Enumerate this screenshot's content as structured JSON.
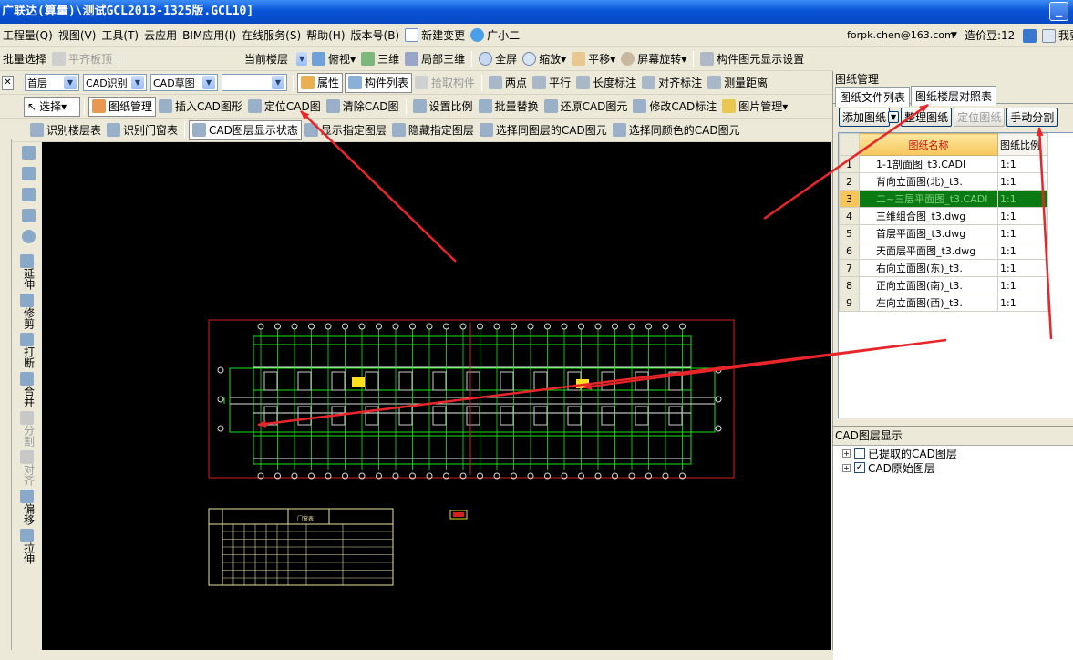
{
  "window": {
    "title": "广联达(算量)\\测试GCL2013-1325版.GCL10]"
  },
  "menubar": {
    "items": [
      "工程量(Q)",
      "视图(V)",
      "工具(T)",
      "云应用",
      "BIM应用(I)",
      "在线服务(S)",
      "帮助(H)",
      "版本号(B)",
      "新建变更",
      "广小二"
    ],
    "account": "forpk.chen@163.com",
    "beans": "造价豆:12",
    "me": "我要"
  },
  "toolbar1": {
    "items": [
      "批量选择",
      "平齐板顶",
      "当前楼层",
      "俯视",
      "三维",
      "局部三维",
      "全屏",
      "缩放",
      "平移",
      "屏幕旋转",
      "构件图元显示设置"
    ]
  },
  "toolbar2": {
    "floor": "首层",
    "cad_recog": "CAD识别",
    "cad_draft": "CAD草图",
    "blank": "",
    "items": [
      "属性",
      "构件列表",
      "拾取构件",
      "两点",
      "平行",
      "长度标注",
      "对齐标注",
      "测量距离"
    ]
  },
  "toolbar3": {
    "items": [
      "选择",
      "图纸管理",
      "插入CAD图形",
      "定位CAD图",
      "清除CAD图",
      "设置比例",
      "批量替换",
      "还原CAD图元",
      "修改CAD标注",
      "图片管理"
    ]
  },
  "toolbar4": {
    "items": [
      "识别楼层表",
      "识别门窗表",
      "CAD图层显示状态",
      "显示指定图层",
      "隐藏指定图层",
      "选择同图层的CAD图元",
      "选择同颜色的CAD图元"
    ]
  },
  "lefttools": [
    "延伸",
    "修剪",
    "打断",
    "合并",
    "分割",
    "对齐",
    "偏移",
    "拉伸"
  ],
  "panel": {
    "title": "图纸管理",
    "tabs": [
      "图纸文件列表",
      "图纸楼层对照表"
    ],
    "buttons": [
      "添加图纸",
      "整理图纸",
      "定位图纸",
      "手动分割"
    ],
    "headers": [
      "图纸名称",
      "图纸比例"
    ],
    "rows": [
      {
        "no": "1",
        "name": "1-1剖面图_t3.CADI",
        "scale": "1:1"
      },
      {
        "no": "2",
        "name": "背向立面图(北)_t3.",
        "scale": "1:1"
      },
      {
        "no": "3",
        "name": "二~三层平面图_t3.CADI",
        "scale": "1:1"
      },
      {
        "no": "4",
        "name": "三维组合图_t3.dwg",
        "scale": "1:1"
      },
      {
        "no": "5",
        "name": "首层平面图_t3.dwg",
        "scale": "1:1"
      },
      {
        "no": "6",
        "name": "天面层平面图_t3.dwg",
        "scale": "1:1"
      },
      {
        "no": "7",
        "name": "右向立面图(东)_t3.",
        "scale": "1:1"
      },
      {
        "no": "8",
        "name": "正向立面图(南)_t3.",
        "scale": "1:1"
      },
      {
        "no": "9",
        "name": "左向立面图(西)_t3.",
        "scale": "1:1"
      }
    ],
    "layer_title": "CAD图层显示",
    "layers": [
      {
        "label": "已提取的CAD图层",
        "checked": false
      },
      {
        "label": "CAD原始图层",
        "checked": true
      }
    ]
  },
  "canvas": {
    "table_title": "门窗表"
  },
  "colors": {
    "title_bar": "#0a55d8",
    "selected_row": "#0b7a12",
    "arrow": "#e8262a",
    "cad_green": "#19e619",
    "frame_red": "#d42020"
  }
}
